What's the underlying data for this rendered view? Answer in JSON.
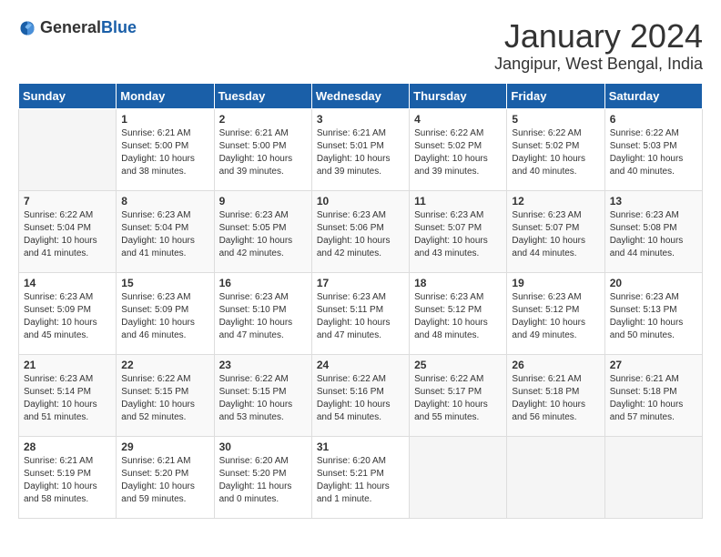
{
  "logo": {
    "general": "General",
    "blue": "Blue"
  },
  "title": "January 2024",
  "location": "Jangipur, West Bengal, India",
  "days_of_week": [
    "Sunday",
    "Monday",
    "Tuesday",
    "Wednesday",
    "Thursday",
    "Friday",
    "Saturday"
  ],
  "weeks": [
    [
      {
        "day": "",
        "info": ""
      },
      {
        "day": "1",
        "info": "Sunrise: 6:21 AM\nSunset: 5:00 PM\nDaylight: 10 hours\nand 38 minutes."
      },
      {
        "day": "2",
        "info": "Sunrise: 6:21 AM\nSunset: 5:00 PM\nDaylight: 10 hours\nand 39 minutes."
      },
      {
        "day": "3",
        "info": "Sunrise: 6:21 AM\nSunset: 5:01 PM\nDaylight: 10 hours\nand 39 minutes."
      },
      {
        "day": "4",
        "info": "Sunrise: 6:22 AM\nSunset: 5:02 PM\nDaylight: 10 hours\nand 39 minutes."
      },
      {
        "day": "5",
        "info": "Sunrise: 6:22 AM\nSunset: 5:02 PM\nDaylight: 10 hours\nand 40 minutes."
      },
      {
        "day": "6",
        "info": "Sunrise: 6:22 AM\nSunset: 5:03 PM\nDaylight: 10 hours\nand 40 minutes."
      }
    ],
    [
      {
        "day": "7",
        "info": "Sunrise: 6:22 AM\nSunset: 5:04 PM\nDaylight: 10 hours\nand 41 minutes."
      },
      {
        "day": "8",
        "info": "Sunrise: 6:23 AM\nSunset: 5:04 PM\nDaylight: 10 hours\nand 41 minutes."
      },
      {
        "day": "9",
        "info": "Sunrise: 6:23 AM\nSunset: 5:05 PM\nDaylight: 10 hours\nand 42 minutes."
      },
      {
        "day": "10",
        "info": "Sunrise: 6:23 AM\nSunset: 5:06 PM\nDaylight: 10 hours\nand 42 minutes."
      },
      {
        "day": "11",
        "info": "Sunrise: 6:23 AM\nSunset: 5:07 PM\nDaylight: 10 hours\nand 43 minutes."
      },
      {
        "day": "12",
        "info": "Sunrise: 6:23 AM\nSunset: 5:07 PM\nDaylight: 10 hours\nand 44 minutes."
      },
      {
        "day": "13",
        "info": "Sunrise: 6:23 AM\nSunset: 5:08 PM\nDaylight: 10 hours\nand 44 minutes."
      }
    ],
    [
      {
        "day": "14",
        "info": "Sunrise: 6:23 AM\nSunset: 5:09 PM\nDaylight: 10 hours\nand 45 minutes."
      },
      {
        "day": "15",
        "info": "Sunrise: 6:23 AM\nSunset: 5:09 PM\nDaylight: 10 hours\nand 46 minutes."
      },
      {
        "day": "16",
        "info": "Sunrise: 6:23 AM\nSunset: 5:10 PM\nDaylight: 10 hours\nand 47 minutes."
      },
      {
        "day": "17",
        "info": "Sunrise: 6:23 AM\nSunset: 5:11 PM\nDaylight: 10 hours\nand 47 minutes."
      },
      {
        "day": "18",
        "info": "Sunrise: 6:23 AM\nSunset: 5:12 PM\nDaylight: 10 hours\nand 48 minutes."
      },
      {
        "day": "19",
        "info": "Sunrise: 6:23 AM\nSunset: 5:12 PM\nDaylight: 10 hours\nand 49 minutes."
      },
      {
        "day": "20",
        "info": "Sunrise: 6:23 AM\nSunset: 5:13 PM\nDaylight: 10 hours\nand 50 minutes."
      }
    ],
    [
      {
        "day": "21",
        "info": "Sunrise: 6:23 AM\nSunset: 5:14 PM\nDaylight: 10 hours\nand 51 minutes."
      },
      {
        "day": "22",
        "info": "Sunrise: 6:22 AM\nSunset: 5:15 PM\nDaylight: 10 hours\nand 52 minutes."
      },
      {
        "day": "23",
        "info": "Sunrise: 6:22 AM\nSunset: 5:15 PM\nDaylight: 10 hours\nand 53 minutes."
      },
      {
        "day": "24",
        "info": "Sunrise: 6:22 AM\nSunset: 5:16 PM\nDaylight: 10 hours\nand 54 minutes."
      },
      {
        "day": "25",
        "info": "Sunrise: 6:22 AM\nSunset: 5:17 PM\nDaylight: 10 hours\nand 55 minutes."
      },
      {
        "day": "26",
        "info": "Sunrise: 6:21 AM\nSunset: 5:18 PM\nDaylight: 10 hours\nand 56 minutes."
      },
      {
        "day": "27",
        "info": "Sunrise: 6:21 AM\nSunset: 5:18 PM\nDaylight: 10 hours\nand 57 minutes."
      }
    ],
    [
      {
        "day": "28",
        "info": "Sunrise: 6:21 AM\nSunset: 5:19 PM\nDaylight: 10 hours\nand 58 minutes."
      },
      {
        "day": "29",
        "info": "Sunrise: 6:21 AM\nSunset: 5:20 PM\nDaylight: 10 hours\nand 59 minutes."
      },
      {
        "day": "30",
        "info": "Sunrise: 6:20 AM\nSunset: 5:20 PM\nDaylight: 11 hours\nand 0 minutes."
      },
      {
        "day": "31",
        "info": "Sunrise: 6:20 AM\nSunset: 5:21 PM\nDaylight: 11 hours\nand 1 minute."
      },
      {
        "day": "",
        "info": ""
      },
      {
        "day": "",
        "info": ""
      },
      {
        "day": "",
        "info": ""
      }
    ]
  ]
}
